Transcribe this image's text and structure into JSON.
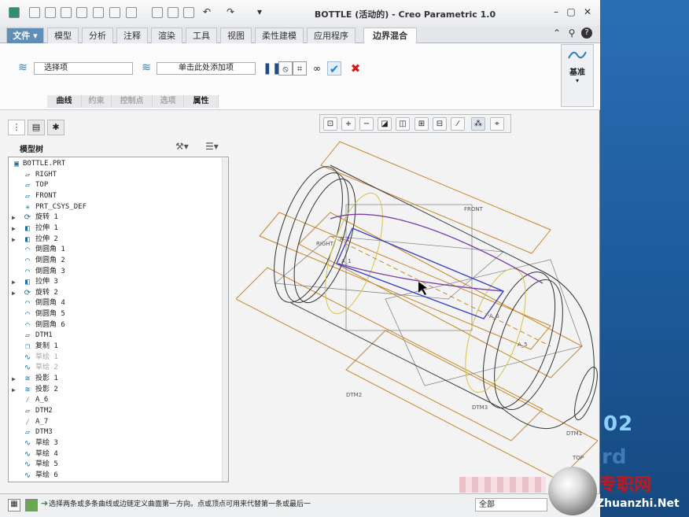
{
  "window": {
    "title": "BOTTLE (活动的) - Creo Parametric 1.0"
  },
  "tabs": [
    {
      "label": "文件"
    },
    {
      "label": "模型"
    },
    {
      "label": "分析"
    },
    {
      "label": "注释"
    },
    {
      "label": "渲染"
    },
    {
      "label": "工具"
    },
    {
      "label": "视图"
    },
    {
      "label": "柔性建模"
    },
    {
      "label": "应用程序"
    },
    {
      "label": "边界混合"
    }
  ],
  "ribbon": {
    "field1": "选择项",
    "field2": "单击此处添加项",
    "subtabs": [
      {
        "label": "曲线",
        "enabled": true
      },
      {
        "label": "约束",
        "enabled": false
      },
      {
        "label": "控制点",
        "enabled": false
      },
      {
        "label": "选项",
        "enabled": false
      },
      {
        "label": "属性",
        "enabled": true
      }
    ],
    "datum_label": "基准"
  },
  "tree": {
    "title": "模型树",
    "items": [
      {
        "label": "BOTTLE.PRT",
        "icon": "part-icon",
        "expand": false,
        "root": true
      },
      {
        "label": "RIGHT",
        "icon": "datum-plane-icon"
      },
      {
        "label": "TOP",
        "icon": "datum-plane-icon"
      },
      {
        "label": "FRONT",
        "icon": "datum-plane-icon"
      },
      {
        "label": "PRT_CSYS_DEF",
        "icon": "csys-icon"
      },
      {
        "label": "旋转 1",
        "icon": "revolve-icon",
        "expand": true
      },
      {
        "label": "拉伸 1",
        "icon": "extrude-icon",
        "expand": true
      },
      {
        "label": "拉伸 2",
        "icon": "extrude-icon",
        "expand": true
      },
      {
        "label": "倒圆角 1",
        "icon": "round-icon"
      },
      {
        "label": "倒圆角 2",
        "icon": "round-icon"
      },
      {
        "label": "倒圆角 3",
        "icon": "round-icon"
      },
      {
        "label": "拉伸 3",
        "icon": "extrude-icon",
        "expand": true
      },
      {
        "label": "旋转 2",
        "icon": "revolve-icon",
        "expand": true
      },
      {
        "label": "倒圆角 4",
        "icon": "round-icon"
      },
      {
        "label": "倒圆角 5",
        "icon": "round-icon"
      },
      {
        "label": "倒圆角 6",
        "icon": "round-icon"
      },
      {
        "label": "DTM1",
        "icon": "datum-plane-icon"
      },
      {
        "label": "复制 1",
        "icon": "copy-icon"
      },
      {
        "label": "草绘 1",
        "icon": "sketch-icon",
        "gray": true
      },
      {
        "label": "草绘 2",
        "icon": "sketch-icon",
        "gray": true
      },
      {
        "label": "投影 1",
        "icon": "project-icon",
        "expand": true
      },
      {
        "label": "投影 2",
        "icon": "project-icon",
        "expand": true
      },
      {
        "label": "A_6",
        "icon": "axis-icon"
      },
      {
        "label": "DTM2",
        "icon": "datum-plane-icon"
      },
      {
        "label": "A_7",
        "icon": "axis-icon"
      },
      {
        "label": "DTM3",
        "icon": "datum-plane-icon"
      },
      {
        "label": "草绘 3",
        "icon": "sketch-icon"
      },
      {
        "label": "草绘 4",
        "icon": "sketch-icon"
      },
      {
        "label": "草绘 5",
        "icon": "sketch-icon"
      },
      {
        "label": "草绘 6",
        "icon": "sketch-icon"
      }
    ]
  },
  "graphics": {
    "labels": [
      "RIGHT",
      "FRONT",
      "A_2",
      "A_1",
      "A_6",
      "A_5",
      "DTM2",
      "DTM3",
      "DTM1",
      "TOP"
    ]
  },
  "status": {
    "message": "选择两条或多条曲线或边链定义曲面第一方向。点或顶点可用来代替第一条或最后一",
    "filter": "全部"
  },
  "watermark": {
    "text": "专职网",
    "url": "Zhuanzhi.Net",
    "desk_number": "02",
    "desk_faint": "rd"
  },
  "colors": {
    "accent": "#1a6fa0",
    "model_line": "#c8862a",
    "curve": "#3b42c8",
    "purple": "#7a3fa8"
  }
}
